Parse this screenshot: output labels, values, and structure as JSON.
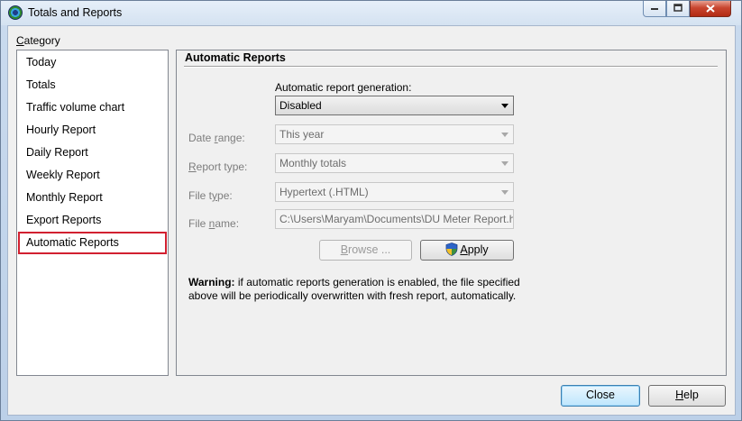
{
  "window": {
    "title": "Totals and Reports",
    "controls": {
      "minimize": "▭",
      "maximize": "□",
      "close": "✕"
    }
  },
  "sidebar": {
    "label_prefix": "",
    "label_underline": "C",
    "label_rest": "ategory",
    "items": [
      {
        "label": "Today"
      },
      {
        "label": "Totals"
      },
      {
        "label": "Traffic volume chart"
      },
      {
        "label": "Hourly Report"
      },
      {
        "label": "Daily Report"
      },
      {
        "label": "Weekly Report"
      },
      {
        "label": "Monthly Report"
      },
      {
        "label": "Export Reports"
      },
      {
        "label": "Automatic Reports",
        "selected": true
      }
    ]
  },
  "panel": {
    "title": "Automatic Reports",
    "generation_label": "Automatic report generation:",
    "generation_value": "Disabled",
    "date_range": {
      "label_pre": "Date ",
      "label_u": "r",
      "label_post": "ange:",
      "value": "This year"
    },
    "report_type": {
      "label_pre": "",
      "label_u": "R",
      "label_post": "eport type:",
      "value": "Monthly totals"
    },
    "file_type": {
      "label_pre": "File t",
      "label_u": "y",
      "label_post": "pe:",
      "value": "Hypertext (.HTML)"
    },
    "file_name": {
      "label_pre": "File ",
      "label_u": "n",
      "label_post": "ame:",
      "value": "C:\\Users\\Maryam\\Documents\\DU Meter Report.h"
    },
    "browse_u": "B",
    "browse_rest": "rowse ...",
    "apply_u": "A",
    "apply_rest": "pply",
    "warning_bold": "Warning:",
    "warning_text": " if automatic reports generation is enabled, the file specified above will be periodically overwritten with fresh report, automatically."
  },
  "footer": {
    "close_label": "Close",
    "help_u": "H",
    "help_rest": "elp"
  },
  "colors": {
    "selection_outline": "#d22030",
    "titlebar_close": "#c8452f"
  }
}
